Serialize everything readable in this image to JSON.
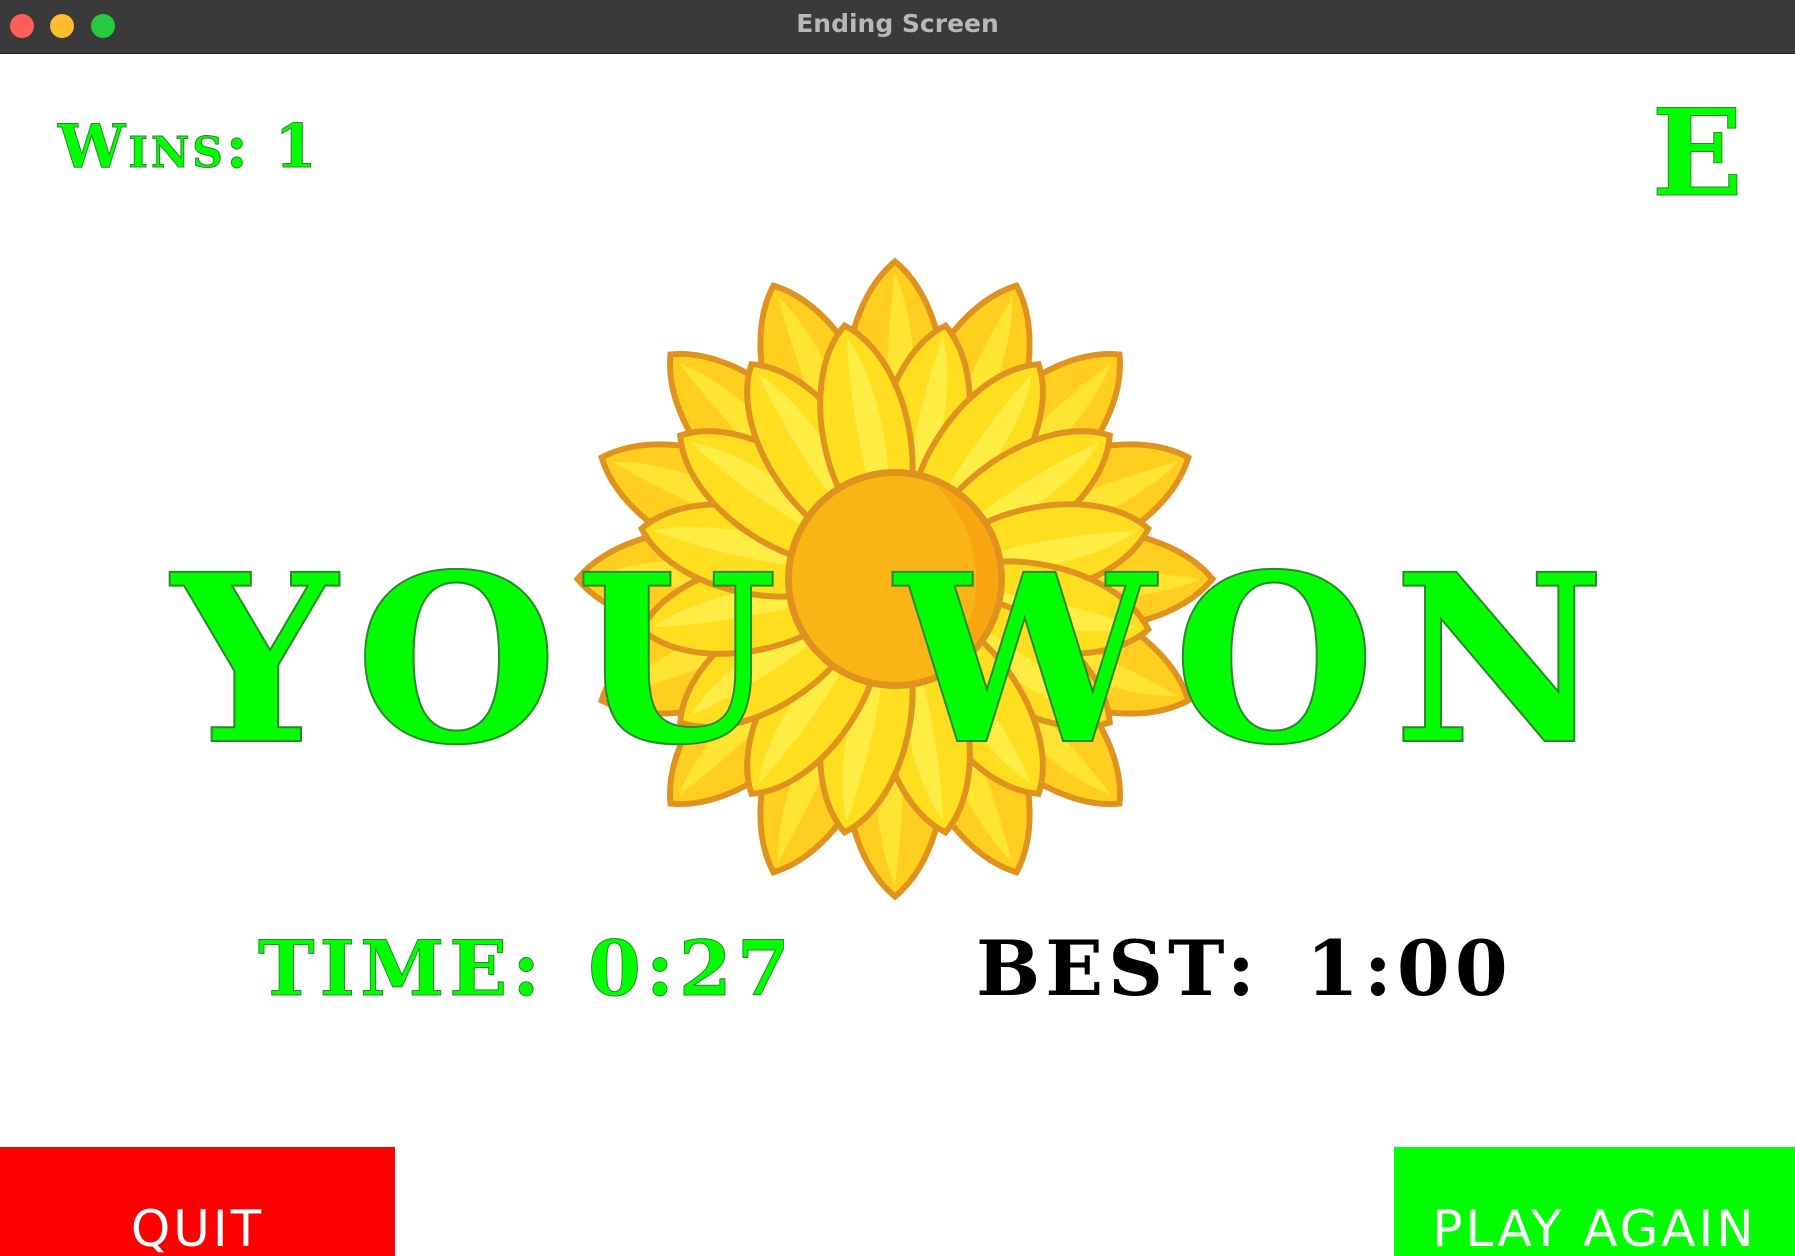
{
  "window": {
    "title": "Ending Screen"
  },
  "scoreboard": {
    "wins_label": "Wins: 1",
    "grade": "E"
  },
  "result": {
    "message": "YOU WON"
  },
  "stats": {
    "time_label": "TIME:",
    "time_value": "0:27",
    "best_label": "BEST:",
    "best_value": "1:00"
  },
  "buttons": {
    "quit": "QUIT",
    "play_again": "PLAY AGAIN"
  },
  "colors": {
    "accent_green": "#00ff00",
    "quit_red": "#ff0000",
    "petal_yellow": "#ffe21e",
    "center_orange": "#fbb416"
  },
  "icons": {
    "background": "sunflower"
  }
}
